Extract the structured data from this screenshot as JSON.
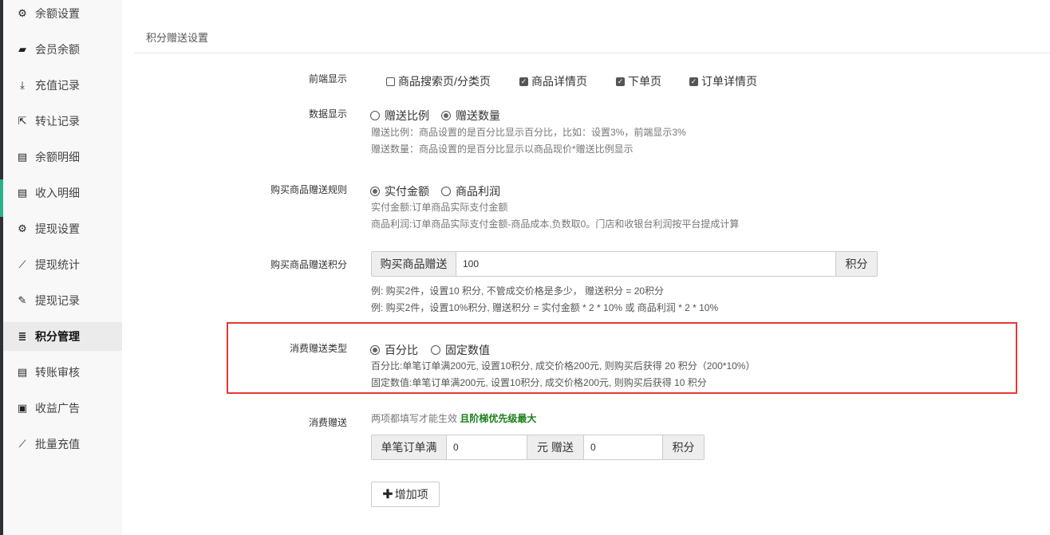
{
  "sidebar": {
    "items": [
      {
        "label": "余额设置",
        "icon": "gear-icon",
        "glyph": "⚙"
      },
      {
        "label": "会员余额",
        "icon": "book-icon",
        "glyph": "▰"
      },
      {
        "label": "充值记录",
        "icon": "download-icon",
        "glyph": "⤓"
      },
      {
        "label": "转让记录",
        "icon": "external-link-icon",
        "glyph": "⇱"
      },
      {
        "label": "余额明细",
        "icon": "document-icon",
        "glyph": "▤"
      },
      {
        "label": "收入明细",
        "icon": "document-icon",
        "glyph": "▤"
      },
      {
        "label": "提现设置",
        "icon": "gear-icon",
        "glyph": "⚙"
      },
      {
        "label": "提现统计",
        "icon": "line-chart-icon",
        "glyph": "⟋"
      },
      {
        "label": "提现记录",
        "icon": "pencil-icon",
        "glyph": "✎"
      },
      {
        "label": "积分管理",
        "icon": "database-icon",
        "glyph": "≣",
        "active": true
      },
      {
        "label": "转账审核",
        "icon": "document-icon",
        "glyph": "▤"
      },
      {
        "label": "收益广告",
        "icon": "image-icon",
        "glyph": "▣"
      },
      {
        "label": "批量充值",
        "icon": "line-chart-icon",
        "glyph": "⟋"
      }
    ]
  },
  "section": {
    "title": "积分赠送设置"
  },
  "frontend": {
    "label": "前端显示",
    "options": [
      {
        "label": "商品搜索页/分类页",
        "checked": false
      },
      {
        "label": "商品详情页",
        "checked": true
      },
      {
        "label": "下单页",
        "checked": true
      },
      {
        "label": "订单详情页",
        "checked": true
      }
    ]
  },
  "data_display": {
    "label": "数据显示",
    "options": [
      {
        "label": "赠送比例",
        "selected": false
      },
      {
        "label": "赠送数量",
        "selected": true
      }
    ],
    "help1": "赠送比例：商品设置的是百分比显示百分比，比如：设置3%，前端显示3%",
    "help2": "赠送数量：商品设置的是百分比显示以商品现价*赠送比例显示"
  },
  "buy_rule": {
    "label": "购买商品赠送规则",
    "options": [
      {
        "label": "实付金额",
        "selected": true
      },
      {
        "label": "商品利润",
        "selected": false
      }
    ],
    "help1": "实付金额:订单商品实际支付金额",
    "help2": "商品利润:订单商品实际支付金额-商品成本,负数取0。门店和收银台利润按平台提成计算"
  },
  "buy_points": {
    "label": "购买商品赠送积分",
    "prefix": "购买商品赠送",
    "value": "100",
    "suffix": "积分",
    "help1": "例: 购买2件，设置10 积分, 不管成交价格是多少， 赠送积分 = 20积分",
    "help2": "例: 购买2件，设置10%积分, 赠送积分 = 实付金额 * 2 * 10% 或 商品利润 * 2 * 10%"
  },
  "consume_type": {
    "label": "消费赠送类型",
    "options": [
      {
        "label": "百分比",
        "selected": true
      },
      {
        "label": "固定数值",
        "selected": false
      }
    ],
    "help1": "百分比:单笔订单满200元, 设置10积分, 成交价格200元, 则购买后获得 20 积分（200*10%）",
    "help2": "固定数值:单笔订单满200元, 设置10积分, 成交价格200元, 则购买后获得 10 积分"
  },
  "consume_gift": {
    "label": "消费赠送",
    "help_prefix": "两项都填写才能生效 ",
    "help_bold": "且阶梯优先级最大",
    "prefix": "单笔订单满",
    "value1": "0",
    "middle": "元 赠送",
    "value2": "0",
    "suffix": "积分",
    "add_label": "增加项"
  }
}
